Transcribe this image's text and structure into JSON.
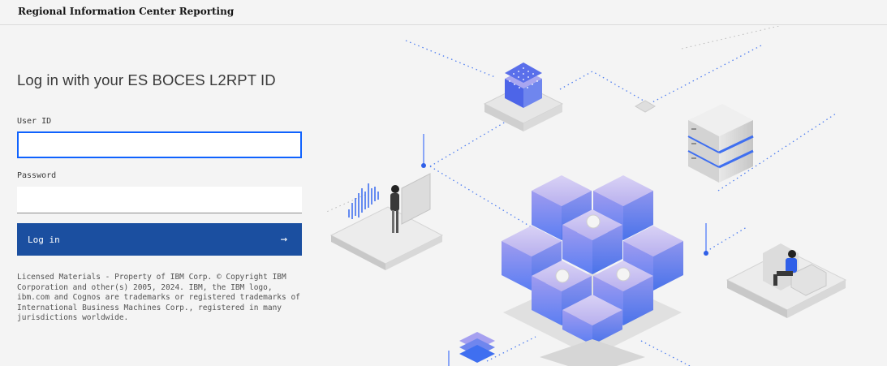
{
  "header": {
    "title": "Regional Information Center Reporting"
  },
  "login": {
    "heading": "Log in with your ES BOCES L2RPT ID",
    "user_label": "User ID",
    "user_value": "",
    "password_label": "Password",
    "password_value": "",
    "button_label": "Log in",
    "button_icon": "arrow-right-icon",
    "legal_text": "Licensed Materials - Property of IBM Corp. © Copyright IBM Corporation and other(s) 2005, 2024. IBM, the IBM logo, ibm.com and Cognos are trademarks or registered trademarks of International Business Machines Corp., registered in many jurisdictions worldwide."
  },
  "colors": {
    "accent": "#0f62fe",
    "button": "#1b4fa0",
    "background": "#f4f4f4"
  }
}
